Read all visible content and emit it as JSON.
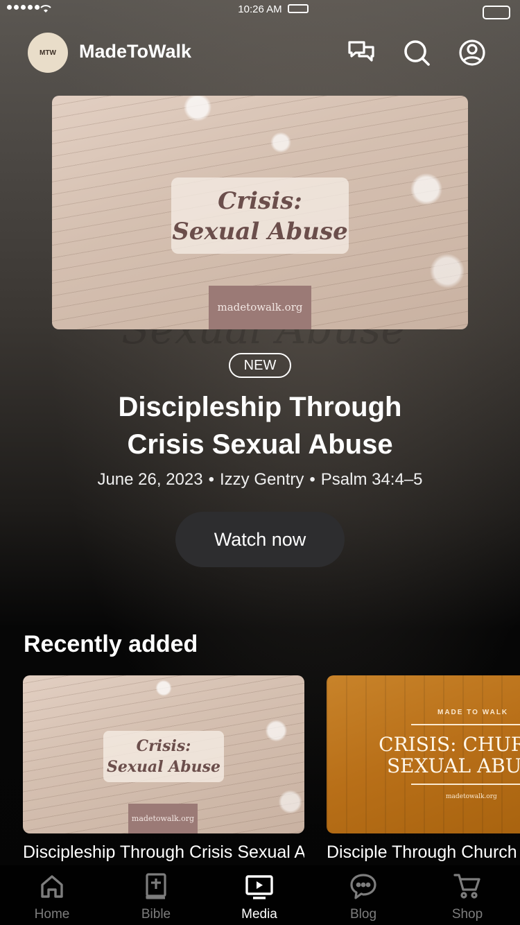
{
  "status_bar": {
    "time": "10:26 AM"
  },
  "header": {
    "app_name": "MadeToWalk",
    "logo_text": "MTW",
    "icons": [
      "chat-bubbles-icon",
      "search-icon",
      "account-icon"
    ]
  },
  "hero": {
    "image_title_line1": "Crisis:",
    "image_title_line2": "Sexual Abuse",
    "image_url": "madetowalk.org",
    "badge": "NEW",
    "title": "Discipleship Through Crisis Sexual Abuse",
    "date": "June 26, 2023",
    "author": "Izzy Gentry",
    "scripture": "Psalm 34:4–5",
    "separator": "•",
    "button_label": "Watch now"
  },
  "recently_added": {
    "title": "Recently added",
    "items": [
      {
        "image_title_line1": "Crisis:",
        "image_title_line2": "Sexual Abuse",
        "image_url": "madetowalk.org",
        "caption": "Discipleship Through Crisis Sexual Abuse"
      },
      {
        "brand": "MADE TO WALK",
        "headline_line1": "CRISIS: CHURCH",
        "headline_line2": "SEXUAL ABUSE",
        "image_url": "madetowalk.org",
        "caption": "Disciple Through Church Sexual Abuse"
      }
    ]
  },
  "tab_bar": {
    "tabs": [
      {
        "label": "Home",
        "icon": "home-icon",
        "active": false
      },
      {
        "label": "Bible",
        "icon": "bible-icon",
        "active": false
      },
      {
        "label": "Media",
        "icon": "tv-play-icon",
        "active": true
      },
      {
        "label": "Blog",
        "icon": "chat-bubble-icon",
        "active": false
      },
      {
        "label": "Shop",
        "icon": "cart-icon",
        "active": false
      }
    ]
  }
}
